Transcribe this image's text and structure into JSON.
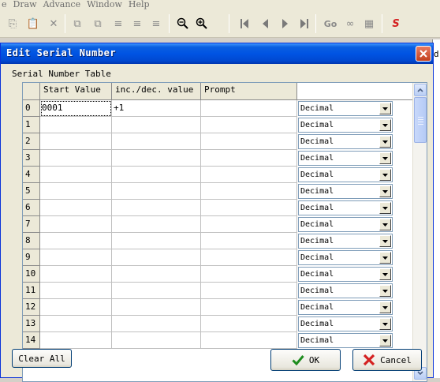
{
  "app": {
    "menu": [
      "e",
      "Draw",
      "Advance",
      "Window",
      "Help"
    ],
    "right_edge_label": "d"
  },
  "toolbar": {
    "go_label": "Go"
  },
  "dialog": {
    "title": "Edit Serial Number",
    "group_label": "Serial Number Table",
    "columns": [
      "",
      "Start Value",
      "inc./dec. value",
      "Prompt",
      ""
    ],
    "rows": [
      {
        "index": "0",
        "start": "0001",
        "inc": "+1",
        "prompt": "",
        "format": "Decimal"
      },
      {
        "index": "1",
        "start": "",
        "inc": "",
        "prompt": "",
        "format": "Decimal"
      },
      {
        "index": "2",
        "start": "",
        "inc": "",
        "prompt": "",
        "format": "Decimal"
      },
      {
        "index": "3",
        "start": "",
        "inc": "",
        "prompt": "",
        "format": "Decimal"
      },
      {
        "index": "4",
        "start": "",
        "inc": "",
        "prompt": "",
        "format": "Decimal"
      },
      {
        "index": "5",
        "start": "",
        "inc": "",
        "prompt": "",
        "format": "Decimal"
      },
      {
        "index": "6",
        "start": "",
        "inc": "",
        "prompt": "",
        "format": "Decimal"
      },
      {
        "index": "7",
        "start": "",
        "inc": "",
        "prompt": "",
        "format": "Decimal"
      },
      {
        "index": "8",
        "start": "",
        "inc": "",
        "prompt": "",
        "format": "Decimal"
      },
      {
        "index": "9",
        "start": "",
        "inc": "",
        "prompt": "",
        "format": "Decimal"
      },
      {
        "index": "10",
        "start": "",
        "inc": "",
        "prompt": "",
        "format": "Decimal"
      },
      {
        "index": "11",
        "start": "",
        "inc": "",
        "prompt": "",
        "format": "Decimal"
      },
      {
        "index": "12",
        "start": "",
        "inc": "",
        "prompt": "",
        "format": "Decimal"
      },
      {
        "index": "13",
        "start": "",
        "inc": "",
        "prompt": "",
        "format": "Decimal"
      },
      {
        "index": "14",
        "start": "",
        "inc": "",
        "prompt": "",
        "format": "Decimal"
      }
    ],
    "buttons": {
      "clear_all": "Clear All",
      "ok": "OK",
      "cancel": "Cancel"
    }
  },
  "colors": {
    "title_bar": "#0054e3",
    "ok_icon": "#1e8c1e",
    "cancel_icon": "#d42020",
    "close_button": "#d5502c"
  },
  "icons": [
    "close-icon",
    "checkmark-icon",
    "x-cancel-icon",
    "chevron-down-icon",
    "scroll-up-icon",
    "scroll-down-icon",
    "zoom-out-icon",
    "zoom-in-icon",
    "first-icon",
    "prev-icon",
    "next-icon",
    "last-icon"
  ]
}
